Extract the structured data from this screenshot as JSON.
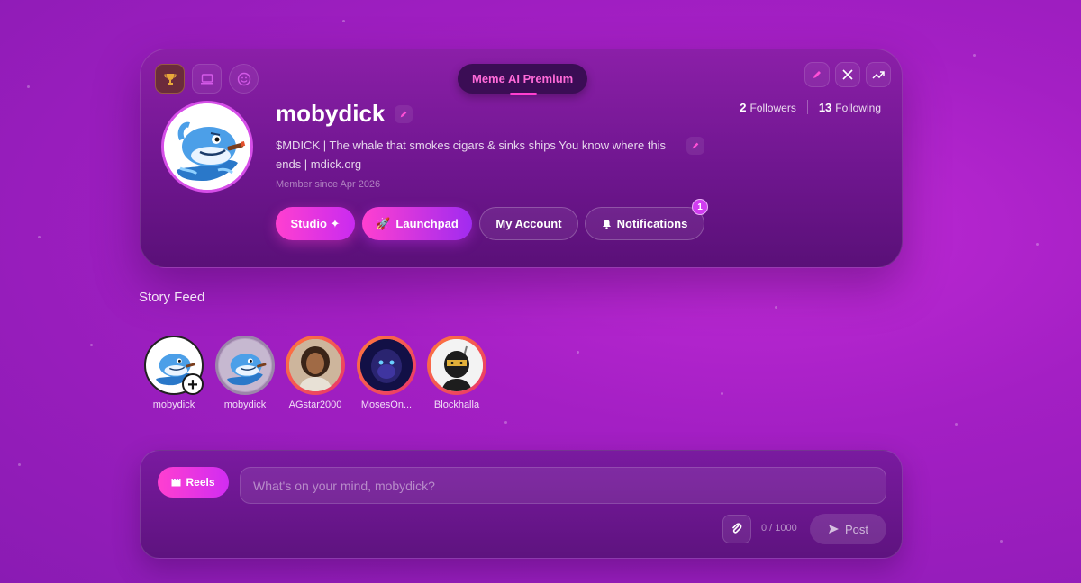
{
  "profile": {
    "premium_label": "Meme AI Premium",
    "username": "mobydick",
    "bio": "$MDICK | The whale that smokes cigars & sinks ships You know where this ends | mdick.org",
    "member_since": "Member since Apr 2026",
    "followers_count": "2",
    "followers_label": "Followers",
    "following_count": "13",
    "following_label": "Following",
    "top_left_icons": [
      "trophy-icon",
      "laptop-icon",
      "smiley-icon"
    ],
    "top_right_icons": [
      "edit-icon",
      "x-logo-icon",
      "trending-icon"
    ],
    "buttons": {
      "studio": "Studio ✦",
      "launchpad": "Launchpad",
      "my_account": "My Account",
      "notifications": "Notifications",
      "notifications_badge": "1"
    }
  },
  "story_feed": {
    "title": "Story Feed",
    "stories": [
      {
        "name": "mobydick",
        "type": "add-story"
      },
      {
        "name": "mobydick",
        "type": "seen"
      },
      {
        "name": "AGstar2000",
        "type": "new"
      },
      {
        "name": "MosesOn...",
        "type": "new"
      },
      {
        "name": "Blockhalla",
        "type": "new"
      }
    ]
  },
  "composer": {
    "reels_label": "Reels",
    "placeholder": "What's on your mind, mobydick?",
    "counter": "0 / 1000",
    "post_label": "Post"
  },
  "colors": {
    "accent": "#ff3fd0",
    "background": "#b020cc",
    "card": "#6f168f"
  }
}
